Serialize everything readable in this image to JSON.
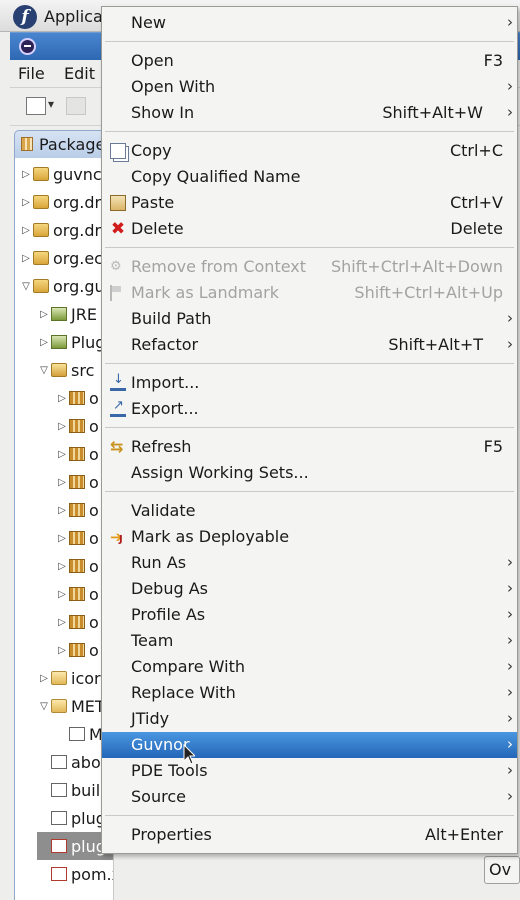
{
  "top_panel": {
    "apps_menu_label": "Applica",
    "logo_glyph": "f"
  },
  "window": {
    "menubar": [
      {
        "label": "File"
      },
      {
        "label": "Edit"
      }
    ],
    "view_tab_label": "Package"
  },
  "tree": {
    "rows": [
      {
        "label": "guvnc",
        "twisty": "▷",
        "icon": "project-icon",
        "indent": 0
      },
      {
        "label": "org.dr",
        "twisty": "▷",
        "icon": "project-icon",
        "indent": 0
      },
      {
        "label": "org.dr",
        "twisty": "▷",
        "icon": "project-icon",
        "indent": 0
      },
      {
        "label": "org.ec",
        "twisty": "▷",
        "icon": "project-icon",
        "indent": 0
      },
      {
        "label": "org.gu",
        "twisty": "▽",
        "icon": "project-icon",
        "indent": 0
      },
      {
        "label": "JRE",
        "twisty": "▷",
        "icon": "library-icon",
        "indent": 1
      },
      {
        "label": "Plug",
        "twisty": "▷",
        "icon": "library-icon",
        "indent": 1
      },
      {
        "label": "src",
        "twisty": "▽",
        "icon": "source-folder-icon",
        "indent": 1
      },
      {
        "label": "o",
        "twisty": "▷",
        "icon": "package-icon",
        "indent": 2
      },
      {
        "label": "o",
        "twisty": "▷",
        "icon": "package-icon",
        "indent": 2
      },
      {
        "label": "o",
        "twisty": "▷",
        "icon": "package-icon",
        "indent": 2
      },
      {
        "label": "o",
        "twisty": "▷",
        "icon": "package-icon",
        "indent": 2
      },
      {
        "label": "o",
        "twisty": "▷",
        "icon": "package-icon",
        "indent": 2
      },
      {
        "label": "o",
        "twisty": "▷",
        "icon": "package-icon",
        "indent": 2
      },
      {
        "label": "o",
        "twisty": "▷",
        "icon": "package-icon",
        "indent": 2
      },
      {
        "label": "o",
        "twisty": "▷",
        "icon": "package-icon",
        "indent": 2
      },
      {
        "label": "o",
        "twisty": "▷",
        "icon": "package-icon",
        "indent": 2
      },
      {
        "label": "o",
        "twisty": "▷",
        "icon": "package-icon",
        "indent": 2
      },
      {
        "label": "icor",
        "twisty": "▷",
        "icon": "folder-icon",
        "indent": 1
      },
      {
        "label": "MET",
        "twisty": "▽",
        "icon": "folder-icon",
        "indent": 1
      },
      {
        "label": "M",
        "twisty": "",
        "icon": "manifest-icon",
        "indent": 2
      },
      {
        "label": "abo",
        "twisty": "",
        "icon": "html-file-icon",
        "indent": 1
      },
      {
        "label": "buil",
        "twisty": "",
        "icon": "properties-file-icon",
        "indent": 1
      },
      {
        "label": "plug",
        "twisty": "",
        "icon": "properties-file-icon",
        "indent": 1
      },
      {
        "label": "plugin.xml",
        "twisty": "",
        "icon": "xml-file-icon",
        "indent": 1,
        "selected": true
      },
      {
        "label": "pom.xml",
        "twisty": "",
        "icon": "xml-file-icon",
        "indent": 1
      }
    ]
  },
  "side_button_label": "Ov",
  "context_menu": {
    "groups": [
      [
        {
          "label": "New",
          "arrow": true
        }
      ],
      [
        {
          "label": "Open",
          "accel": "F3"
        },
        {
          "label": "Open With",
          "arrow": true
        },
        {
          "label": "Show In",
          "accel": "Shift+Alt+W",
          "arrow": true
        }
      ],
      [
        {
          "label": "Copy",
          "accel": "Ctrl+C",
          "icon": "copy-icon"
        },
        {
          "label": "Copy Qualified Name"
        },
        {
          "label": "Paste",
          "accel": "Ctrl+V",
          "icon": "paste-icon"
        },
        {
          "label": "Delete",
          "accel": "Delete",
          "icon": "delete-icon"
        }
      ],
      [
        {
          "label": "Remove from Context",
          "accel": "Shift+Ctrl+Alt+Down",
          "icon": "remove-context-icon",
          "disabled": true
        },
        {
          "label": "Mark as Landmark",
          "accel": "Shift+Ctrl+Alt+Up",
          "icon": "landmark-icon",
          "disabled": true
        },
        {
          "label": "Build Path",
          "arrow": true
        },
        {
          "label": "Refactor",
          "accel": "Shift+Alt+T",
          "arrow": true
        }
      ],
      [
        {
          "label": "Import...",
          "icon": "import-icon"
        },
        {
          "label": "Export...",
          "icon": "export-icon"
        }
      ],
      [
        {
          "label": "Refresh",
          "accel": "F5",
          "icon": "refresh-icon"
        },
        {
          "label": "Assign Working Sets..."
        }
      ],
      [
        {
          "label": "Validate"
        },
        {
          "label": "Mark as Deployable",
          "icon": "deployable-icon"
        },
        {
          "label": "Run As",
          "arrow": true
        },
        {
          "label": "Debug As",
          "arrow": true
        },
        {
          "label": "Profile As",
          "arrow": true
        },
        {
          "label": "Team",
          "arrow": true
        },
        {
          "label": "Compare With",
          "arrow": true
        },
        {
          "label": "Replace With",
          "arrow": true
        },
        {
          "label": "JTidy",
          "arrow": true
        },
        {
          "label": "Guvnor",
          "arrow": true,
          "highlighted": true
        },
        {
          "label": "PDE Tools",
          "arrow": true
        },
        {
          "label": "Source",
          "arrow": true
        }
      ],
      [
        {
          "label": "Properties",
          "accel": "Alt+Enter"
        }
      ]
    ],
    "arrow_glyph": "›"
  }
}
